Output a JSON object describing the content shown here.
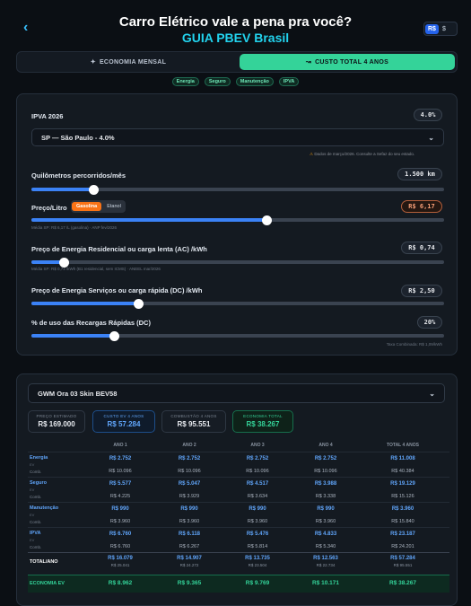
{
  "header": {
    "back_icon": "chevron-left-icon",
    "title": "Carro Elétrico vale a pena pra você?",
    "subtitle": "GUIA PBEV Brasil",
    "currency_active": "R$",
    "currency_inactive": "$"
  },
  "tabs": [
    {
      "label": "ECONOMIA MENSAL",
      "icon": "sparkle-icon",
      "active": false
    },
    {
      "label": "CUSTO TOTAL 4 ANOS",
      "icon": "trend-icon",
      "active": true
    }
  ],
  "chips": [
    "Energia",
    "Seguro",
    "Manutenção",
    "IPVA"
  ],
  "ipva": {
    "label": "IPVA 2026",
    "value": "4.0%",
    "state_selected": "SP — São Paulo - 4.0%",
    "note": "Dados de março/2026. Consulte a Sefaz do seu estado."
  },
  "km": {
    "label": "Quilômetros percorridos/mês",
    "value": "1.500 km",
    "level": 0.15
  },
  "fuel": {
    "label": "Preço/Litro",
    "option_active": "Gasolina",
    "option_inactive": "Etanol",
    "value": "R$ 6,17",
    "note": "Média SP: R$ 6,17 /L (gasolina) · ANP fev/2026",
    "level": 0.57
  },
  "ac": {
    "label": "Preço de Energia Residencial ou carga lenta (AC) /kWh",
    "value": "R$ 0,74",
    "note": "Média SP: R$ 0,74 /kWh (B1 residencial, sem ICMS) · ANEEL mar/2026",
    "level": 0.08
  },
  "dc": {
    "label": "Preço de Energia Serviços ou carga rápida (DC) /kWh",
    "value": "R$ 2,50",
    "level": 0.26
  },
  "fast": {
    "label": "% de uso das Recargas Rápidas (DC)",
    "value": "20%",
    "note": "Taxa Combinada: R$ 1,09/kWh",
    "level": 0.2
  },
  "car": {
    "selected": "GWM Ora 03 Skin BEV58",
    "kpis": [
      {
        "label": "PREÇO ESTIMADO",
        "value": "R$ 169.000",
        "style": "plain"
      },
      {
        "label": "CUSTO EV 4 ANOS",
        "value": "R$ 57.284",
        "style": "blue"
      },
      {
        "label": "COMBUSTÃO 4 ANOS",
        "value": "R$ 95.551",
        "style": "plain"
      },
      {
        "label": "ECONOMIA TOTAL",
        "value": "R$ 38.267",
        "style": "green"
      }
    ]
  },
  "table": {
    "headers": [
      "ANO 1",
      "ANO 2",
      "ANO 3",
      "ANO 4",
      "TOTAL 4 ANOS"
    ],
    "ev_tag": "EV",
    "comb_label": "Comb.",
    "rows": [
      {
        "name": "Energia",
        "ev": [
          "R$ 2.752",
          "R$ 2.752",
          "R$ 2.752",
          "R$ 2.752",
          "R$ 11.008"
        ],
        "comb": [
          "R$ 10.096",
          "R$ 10.096",
          "R$ 10.096",
          "R$ 10.096",
          "R$ 40.384"
        ]
      },
      {
        "name": "Seguro",
        "ev": [
          "R$ 5.577",
          "R$ 5.047",
          "R$ 4.517",
          "R$ 3.988",
          "R$ 19.129"
        ],
        "comb": [
          "R$ 4.225",
          "R$ 3.929",
          "R$ 3.634",
          "R$ 3.338",
          "R$ 15.126"
        ]
      },
      {
        "name": "Manutenção",
        "ev": [
          "R$ 990",
          "R$ 990",
          "R$ 990",
          "R$ 990",
          "R$ 3.960"
        ],
        "comb": [
          "R$ 3.960",
          "R$ 3.960",
          "R$ 3.960",
          "R$ 3.960",
          "R$ 15.840"
        ]
      },
      {
        "name": "IPVA",
        "ev": [
          "R$ 6.760",
          "R$ 6.118",
          "R$ 5.476",
          "R$ 4.833",
          "R$ 23.187"
        ],
        "comb": [
          "R$ 6.760",
          "R$ 6.267",
          "R$ 5.814",
          "R$ 5.340",
          "R$ 24.201"
        ]
      }
    ],
    "total": {
      "label": "TOTAL/ANO",
      "ev": [
        "R$ 16.079",
        "R$ 14.907",
        "R$ 13.735",
        "R$ 12.563",
        "R$ 57.284"
      ],
      "comb": [
        "R$ 25.041",
        "R$ 24.272",
        "R$ 23.504",
        "R$ 22.734",
        "R$ 95.551"
      ]
    },
    "economy": {
      "label": "ECONOMIA EV",
      "values": [
        "R$ 8.962",
        "R$ 9.365",
        "R$ 9.769",
        "R$ 10.171",
        "R$ 38.267"
      ]
    }
  }
}
